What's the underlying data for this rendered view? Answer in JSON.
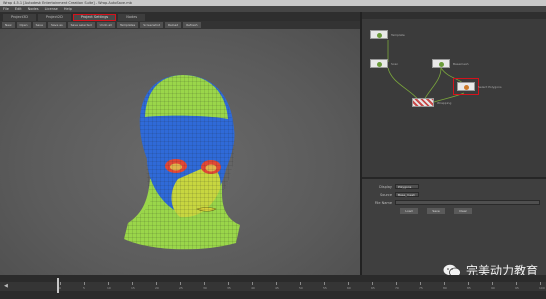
{
  "window": {
    "title": "Wrap 4.5.1 [Autodesk Entertainment Creation Suite] - Wrap.AutoSave.mb"
  },
  "menubar": {
    "items": [
      "File",
      "Edit",
      "Nodes",
      "License",
      "Help"
    ]
  },
  "tabs": [
    {
      "label": "Project3D",
      "active": false
    },
    {
      "label": "Project2D",
      "active": false
    },
    {
      "label": "Project Settings",
      "active": true,
      "highlighted": true
    },
    {
      "label": "Nodes",
      "active": false
    }
  ],
  "toolbar": {
    "buttons": [
      "New",
      "Open",
      "Save",
      "Save as",
      "Save selected",
      "Undo all",
      "Templates",
      "Screenshot",
      "Reload",
      "Refresh"
    ]
  },
  "graph": {
    "nodes": [
      {
        "label": "Template",
        "color": "#6a9b3a"
      },
      {
        "label": "Scan",
        "color": "#6a9b3a"
      },
      {
        "label": "Basemesh",
        "color": "#6a9b3a"
      },
      {
        "label": "Select Polygons",
        "color": "#cc7a2a",
        "highlighted": true
      },
      {
        "label": "Wrapping",
        "color": "#c84a4a"
      }
    ]
  },
  "properties": {
    "rows": [
      {
        "label": "Display",
        "value": "Polygons"
      },
      {
        "label": "Source",
        "value": "Base_mesh"
      },
      {
        "label": "File Name",
        "value": ""
      }
    ],
    "buttons": [
      "Load",
      "Save",
      "Clear"
    ]
  },
  "timeline": {
    "ticks": [
      "0",
      "5",
      "10",
      "15",
      "20",
      "25",
      "30",
      "35",
      "40",
      "45",
      "50",
      "55",
      "60",
      "65",
      "70",
      "75",
      "80",
      "85",
      "90",
      "95",
      "100"
    ]
  },
  "watermark": {
    "text": "完美动力教育",
    "icon": "wechat-icon"
  },
  "colors": {
    "mesh_green": "#9ad64a",
    "mesh_blue": "#2f6ad8",
    "mesh_red": "#e24836",
    "mesh_yellow": "#d9d23a",
    "highlight_red": "#d4121b"
  }
}
